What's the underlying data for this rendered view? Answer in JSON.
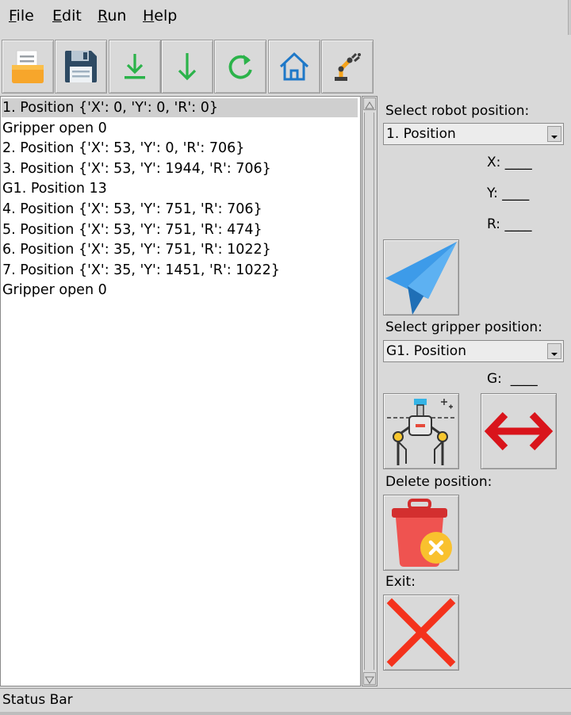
{
  "menu": {
    "file": {
      "mnemonic": "F",
      "rest": "ile"
    },
    "edit": {
      "mnemonic": "E",
      "rest": "dit"
    },
    "run": {
      "mnemonic": "R",
      "rest": "un"
    },
    "help": {
      "mnemonic": "H",
      "rest": "elp"
    }
  },
  "toolbar": {
    "buttons": [
      "open-file-icon",
      "save-icon",
      "download-icon",
      "arrow-down-icon",
      "refresh-icon",
      "home-icon",
      "robot-arm-icon"
    ],
    "colors": {
      "green": "#2bb34a",
      "blue": "#1e78c8",
      "orange": "#f5a31a"
    }
  },
  "list": {
    "items": [
      "1. Position {'X': 0, 'Y': 0, 'R': 0}",
      "Gripper open 0",
      "2. Position {'X': 53, 'Y': 0, 'R': 706}",
      "3. Position {'X': 53, 'Y': 1944, 'R': 706}",
      "G1. Position 13",
      "4. Position {'X': 53, 'Y': 751, 'R': 706}",
      "5. Position {'X': 53, 'Y': 751, 'R': 474}",
      "6. Position {'X': 35, 'Y': 751, 'R': 1022}",
      "7. Position {'X': 35, 'Y': 1451, 'R': 1022}",
      "Gripper open 0"
    ],
    "selected_index": 0
  },
  "panel": {
    "robot_label": "Select robot position:",
    "robot_value": "1. Position",
    "x_label": "X:",
    "x_value": "____",
    "y_label": "Y:",
    "y_value": "____",
    "r_label": "R:",
    "r_value": "____",
    "gripper_label": "Select gripper position:",
    "gripper_value": "G1. Position",
    "g_label": "G:",
    "g_value": "____",
    "delete_label": "Delete position:",
    "exit_label": "Exit:"
  },
  "status": {
    "text": "Status Bar"
  },
  "colors": {
    "send": "#3d9be9",
    "swap": "#d9141b",
    "delete": "#ef5350",
    "exit": "#f4321c"
  }
}
